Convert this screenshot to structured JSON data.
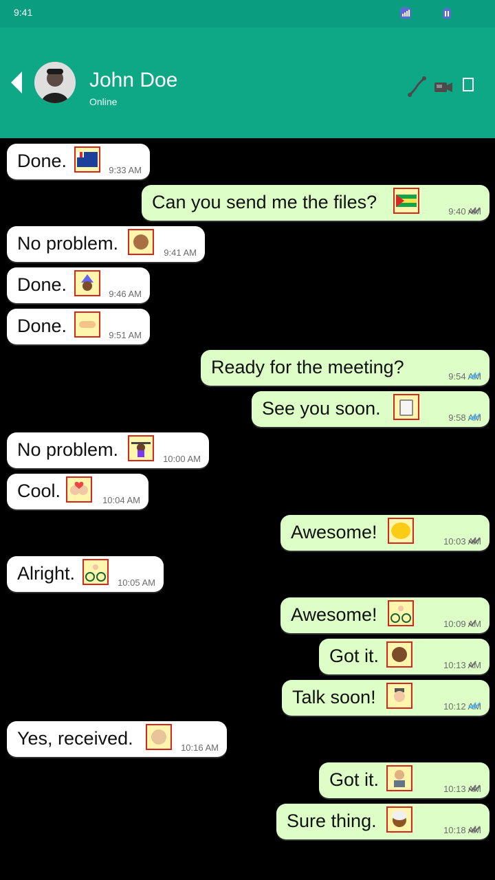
{
  "status_bar": {
    "time": "9:41"
  },
  "header": {
    "contact_name": "John Doe",
    "contact_status": "Online"
  },
  "messages": [
    {
      "direction": "in",
      "text": "Done.",
      "time": "9:33 AM",
      "emoji": "flag-french-southern-territories",
      "ticks": ""
    },
    {
      "direction": "out",
      "text": "Can you send me the files?",
      "time": "9:40 AM",
      "emoji": "flag-sao-tome-and-principe",
      "ticks": "double-gray"
    },
    {
      "direction": "in",
      "text": "No problem.",
      "time": "9:41 AM",
      "emoji": "person-medium-skin",
      "ticks": ""
    },
    {
      "direction": "in",
      "text": "Done.",
      "time": "9:46 AM",
      "emoji": "mage",
      "ticks": ""
    },
    {
      "direction": "in",
      "text": "Done.",
      "time": "9:51 AM",
      "emoji": "handshake",
      "ticks": ""
    },
    {
      "direction": "out",
      "text": "Ready for the meeting?",
      "time": "9:54 AM",
      "emoji": "",
      "ticks": "double-blue"
    },
    {
      "direction": "out",
      "text": "See you soon.",
      "time": "9:58 AM",
      "emoji": "clipboard",
      "ticks": "double-blue"
    },
    {
      "direction": "in",
      "text": "No problem.",
      "time": "10:00 AM",
      "emoji": "weightlifter",
      "ticks": ""
    },
    {
      "direction": "in",
      "text": "Cool.",
      "time": "10:04 AM",
      "emoji": "couple-with-heart",
      "ticks": ""
    },
    {
      "direction": "out",
      "text": "Awesome!",
      "time": "10:03 AM",
      "emoji": "lemon",
      "ticks": "double-gray"
    },
    {
      "direction": "in",
      "text": "Alright.",
      "time": "10:05 AM",
      "emoji": "biker",
      "ticks": ""
    },
    {
      "direction": "out",
      "text": "Awesome!",
      "time": "10:09 AM",
      "emoji": "surfer",
      "ticks": "single-gray"
    },
    {
      "direction": "out",
      "text": "Got it.",
      "time": "10:13 AM",
      "emoji": "woman-dark-skin",
      "ticks": "single-gray"
    },
    {
      "direction": "out",
      "text": "Talk soon!",
      "time": "10:12 AM",
      "emoji": "detective",
      "ticks": "double-blue"
    },
    {
      "direction": "in",
      "text": "Yes, received.",
      "time": "10:16 AM",
      "emoji": "person-light-skin",
      "ticks": ""
    },
    {
      "direction": "out",
      "text": "Got it.",
      "time": "10:13 AM",
      "emoji": "technologist",
      "ticks": "double-gray"
    },
    {
      "direction": "out",
      "text": "Sure thing.",
      "time": "10:18 AM",
      "emoji": "turban-man",
      "ticks": "double-gray"
    }
  ]
}
